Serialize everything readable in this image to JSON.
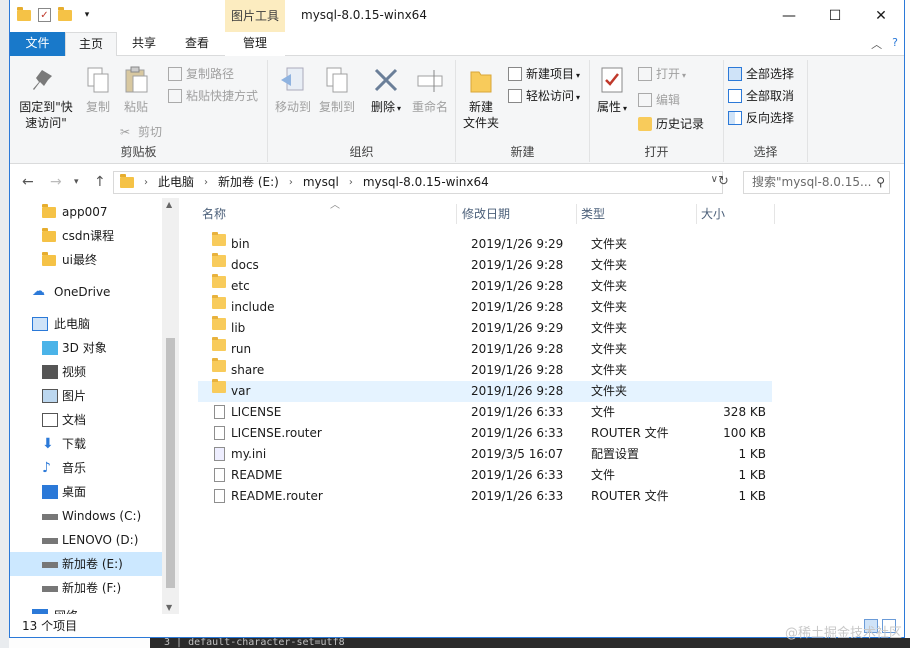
{
  "window": {
    "title": "mysql-8.0.15-winx64",
    "context_tab": "图片工具",
    "controls": {
      "minimize": "—",
      "maximize": "☐",
      "close": "✕"
    }
  },
  "tabs": [
    {
      "label": "文件"
    },
    {
      "label": "主页"
    },
    {
      "label": "共享"
    },
    {
      "label": "查看"
    },
    {
      "label": "管理"
    }
  ],
  "ribbon": {
    "clipboard": {
      "label": "剪贴板",
      "pin": "固定到\"快速访问\"",
      "copy": "复制",
      "paste": "粘贴",
      "copy_path": "复制路径",
      "paste_shortcut": "粘贴快捷方式",
      "cut": "剪切"
    },
    "organize": {
      "label": "组织",
      "move_to": "移动到",
      "copy_to": "复制到",
      "delete": "删除",
      "rename": "重命名"
    },
    "new": {
      "label": "新建",
      "new_folder": "新建\n文件夹",
      "new_item": "新建项目",
      "easy_access": "轻松访问"
    },
    "open": {
      "label": "打开",
      "properties": "属性",
      "open": "打开",
      "edit": "编辑",
      "history": "历史记录"
    },
    "select": {
      "label": "选择",
      "select_all": "全部选择",
      "select_none": "全部取消",
      "invert": "反向选择"
    }
  },
  "address": {
    "crumbs": [
      "此电脑",
      "新加卷 (E:)",
      "mysql",
      "mysql-8.0.15-winx64"
    ],
    "search_placeholder": "搜索\"mysql-8.0.15..."
  },
  "nav": {
    "items": [
      {
        "label": "app007",
        "icon": "folder-icon"
      },
      {
        "label": "csdn课程",
        "icon": "folder-icon"
      },
      {
        "label": "ui最终",
        "icon": "folder-icon"
      },
      {
        "label": "OneDrive",
        "icon": "cloud-icon"
      },
      {
        "label": "此电脑",
        "icon": "computer-icon"
      },
      {
        "label": "3D 对象",
        "icon": "cube-icon"
      },
      {
        "label": "视频",
        "icon": "video-icon"
      },
      {
        "label": "图片",
        "icon": "picture-icon"
      },
      {
        "label": "文档",
        "icon": "document-icon"
      },
      {
        "label": "下载",
        "icon": "download-icon"
      },
      {
        "label": "音乐",
        "icon": "music-icon"
      },
      {
        "label": "桌面",
        "icon": "desktop-icon"
      },
      {
        "label": "Windows (C:)",
        "icon": "drive-icon"
      },
      {
        "label": "LENOVO (D:)",
        "icon": "drive-icon"
      },
      {
        "label": "新加卷 (E:)",
        "icon": "drive-icon"
      },
      {
        "label": "新加卷 (F:)",
        "icon": "drive-icon"
      },
      {
        "label": "网络",
        "icon": "network-icon"
      }
    ]
  },
  "columns": {
    "name": "名称",
    "modified": "修改日期",
    "type": "类型",
    "size": "大小"
  },
  "files": [
    {
      "name": "bin",
      "modified": "2019/1/26 9:29",
      "type": "文件夹",
      "size": "",
      "kind": "folder"
    },
    {
      "name": "docs",
      "modified": "2019/1/26 9:28",
      "type": "文件夹",
      "size": "",
      "kind": "folder"
    },
    {
      "name": "etc",
      "modified": "2019/1/26 9:28",
      "type": "文件夹",
      "size": "",
      "kind": "folder"
    },
    {
      "name": "include",
      "modified": "2019/1/26 9:28",
      "type": "文件夹",
      "size": "",
      "kind": "folder"
    },
    {
      "name": "lib",
      "modified": "2019/1/26 9:29",
      "type": "文件夹",
      "size": "",
      "kind": "folder"
    },
    {
      "name": "run",
      "modified": "2019/1/26 9:28",
      "type": "文件夹",
      "size": "",
      "kind": "folder"
    },
    {
      "name": "share",
      "modified": "2019/1/26 9:28",
      "type": "文件夹",
      "size": "",
      "kind": "folder"
    },
    {
      "name": "var",
      "modified": "2019/1/26 9:28",
      "type": "文件夹",
      "size": "",
      "kind": "folder"
    },
    {
      "name": "LICENSE",
      "modified": "2019/1/26 6:33",
      "type": "文件",
      "size": "328 KB",
      "kind": "file"
    },
    {
      "name": "LICENSE.router",
      "modified": "2019/1/26 6:33",
      "type": "ROUTER 文件",
      "size": "100 KB",
      "kind": "file"
    },
    {
      "name": "my.ini",
      "modified": "2019/3/5 16:07",
      "type": "配置设置",
      "size": "1 KB",
      "kind": "cfg"
    },
    {
      "name": "README",
      "modified": "2019/1/26 6:33",
      "type": "文件",
      "size": "1 KB",
      "kind": "file"
    },
    {
      "name": "README.router",
      "modified": "2019/1/26 6:33",
      "type": "ROUTER 文件",
      "size": "1 KB",
      "kind": "file"
    }
  ],
  "status": {
    "count": "13 个项目"
  },
  "background": {
    "code_line": "3 | default-character-set=utf8",
    "watermark": "@稀土掘金技术社区"
  }
}
